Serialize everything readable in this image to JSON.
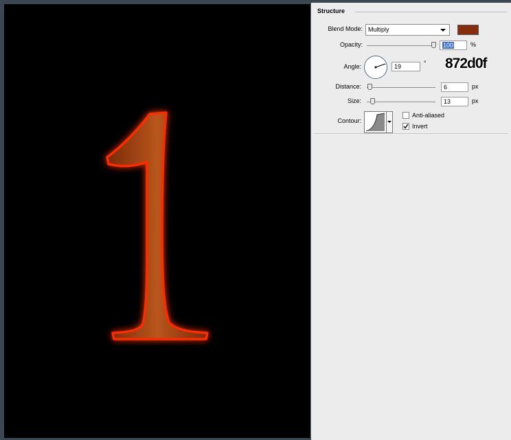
{
  "section": {
    "title": "Structure"
  },
  "blend_mode": {
    "label": "Blend Mode:",
    "value": "Multiply",
    "swatch_color": "#872d0f"
  },
  "opacity": {
    "label": "Opacity:",
    "value": "100",
    "unit": "%",
    "level": 1.0
  },
  "angle": {
    "label": "Angle:",
    "value": "19",
    "unit": "°"
  },
  "annotation": {
    "text": "872d0f"
  },
  "distance": {
    "label": "Distance:",
    "value": "6",
    "unit": "px"
  },
  "size": {
    "label": "Size:",
    "value": "13",
    "unit": "px"
  },
  "contour": {
    "label": "Contour:"
  },
  "anti_aliased": {
    "label": "Anti-aliased",
    "checked": false
  },
  "invert": {
    "label": "Invert",
    "checked": true
  },
  "canvas": {
    "glyph": "1",
    "glyph_color": "#a8400f",
    "glow_color": "#ff2200",
    "background": "#000000"
  }
}
